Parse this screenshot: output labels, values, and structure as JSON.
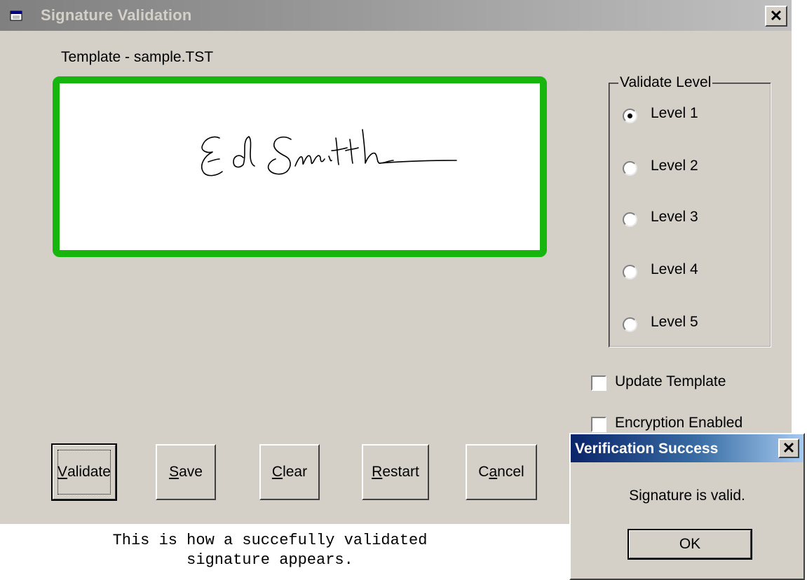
{
  "window": {
    "title": "Signature Validation",
    "close_glyph": "✕",
    "icon": "app-window-icon"
  },
  "template_label": "Template - sample.TST",
  "signature": {
    "border_color": "#16b60e",
    "state": "validated"
  },
  "validate_level": {
    "legend": "Validate Level",
    "options": [
      {
        "label": "Level 1",
        "selected": true
      },
      {
        "label": "Level 2",
        "selected": false
      },
      {
        "label": "Level 3",
        "selected": false
      },
      {
        "label": "Level 4",
        "selected": false
      },
      {
        "label": "Level 5",
        "selected": false
      }
    ]
  },
  "checkboxes": {
    "update_template": {
      "label": "Update Template",
      "checked": false
    },
    "encryption_enabled": {
      "label": "Encryption Enabled",
      "checked": false
    }
  },
  "buttons": {
    "validate": {
      "mnemonic": "V",
      "rest": "alidate"
    },
    "save": {
      "mnemonic": "S",
      "rest": "ave"
    },
    "clear": {
      "mnemonic": "C",
      "rest": "lear"
    },
    "restart": {
      "mnemonic": "R",
      "rest": "estart"
    },
    "cancel": {
      "pre": "C",
      "mnemonic": "a",
      "rest": "ncel"
    }
  },
  "caption": {
    "line1": "This is how a succefully validated",
    "line2": "signature appears."
  },
  "dialog": {
    "title": "Verification Success",
    "close_glyph": "✕",
    "message": "Signature is valid.",
    "ok_label": "OK"
  },
  "colors": {
    "face": "#d4d0c8",
    "success_green": "#16b60e",
    "dialog_title_blue": "#0a246a"
  }
}
